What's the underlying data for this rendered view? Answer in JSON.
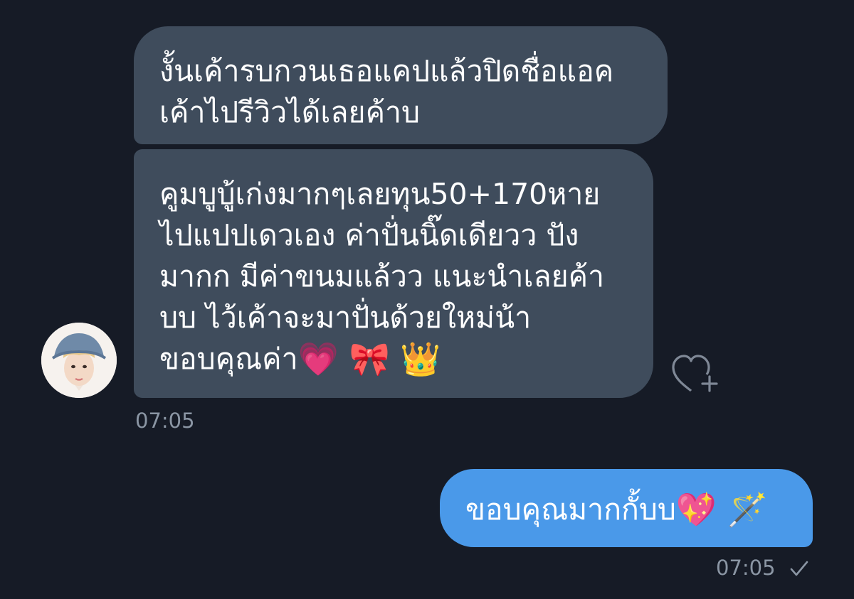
{
  "messages": {
    "incoming": [
      {
        "lines": [
          "งั้นเค้ารบกวนเธอแคปแล้วปิดชื่อแอค",
          "เค้าไปรีวิวได้เลยค้าบ"
        ]
      },
      {
        "lines": [
          "คูมบูบู้เก่งมากๆเลยทุน50+170หาย",
          "ไปแปปเดวเอง ค่าปั่นนิ๊ดเดียวว ปัง",
          "มากก มีค่าขนมแล้วว แนะนำเลยค้า",
          "บบ ไว้เค้าจะมาปั่นด้วยใหม่น้า",
          "ขอบคุณค่า"
        ],
        "trailing_emoji": "💗 🎀 👑"
      }
    ],
    "incoming_time": "07:05",
    "outgoing": {
      "text": "ขอบคุณมากกั้บบ",
      "trailing_emoji": "💖 🪄",
      "time": "07:05"
    }
  },
  "icons": {
    "avatar": "user-avatar",
    "reaction": "heart-add-icon",
    "status": "read-check-icon"
  },
  "colors": {
    "background": "#161b26",
    "incoming_bubble": "#3f4c5c",
    "outgoing_bubble": "#4a99e9",
    "timestamp": "#8b96a4"
  }
}
